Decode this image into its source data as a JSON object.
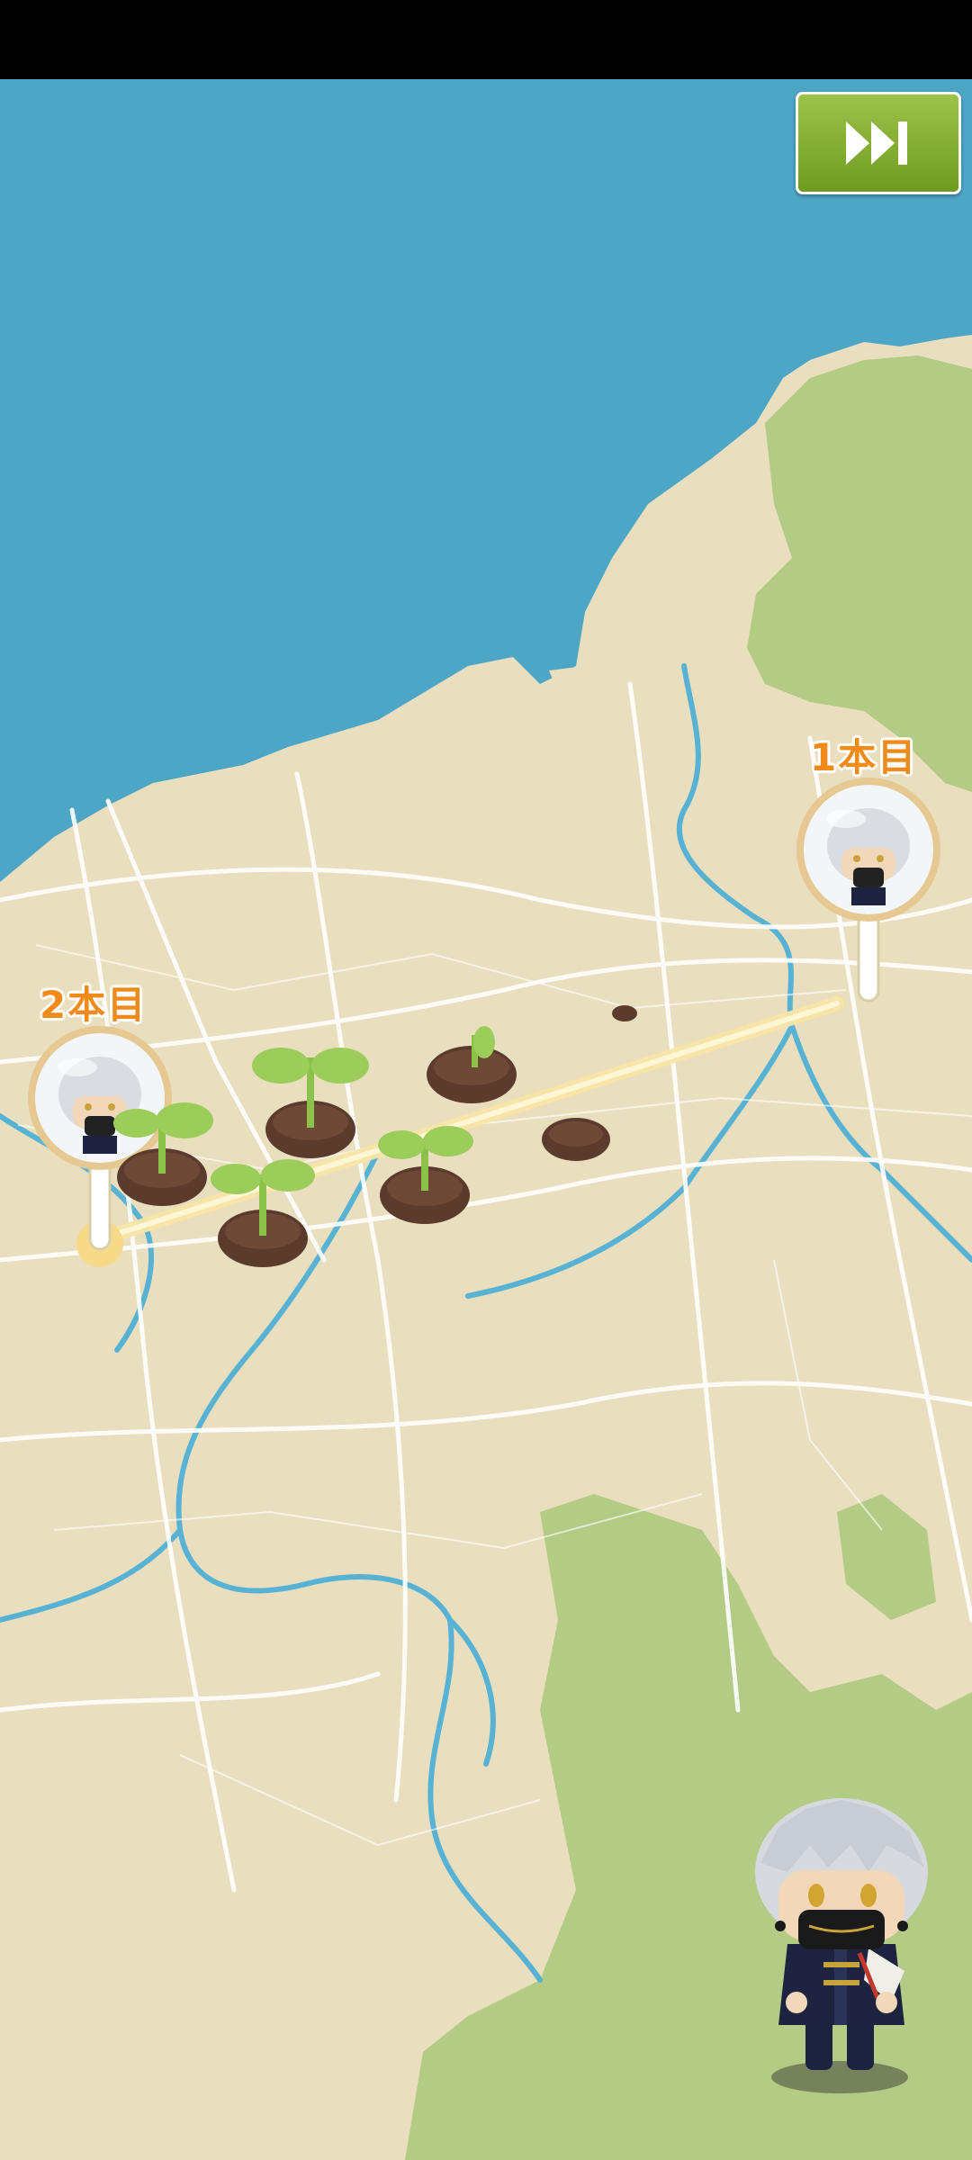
{
  "screen": "map-travel",
  "skip_button": {
    "icon": "fast-forward-icon",
    "color": "#8db33a"
  },
  "pins": [
    {
      "label": "1本目",
      "icon": "character-portrait-icon"
    },
    {
      "label": "2本目",
      "icon": "character-portrait-icon"
    }
  ],
  "sprouts_planted": 5,
  "plots_total": 7,
  "colors": {
    "sea": "#4ea6c7",
    "land": "#e9dfbf",
    "forest": "#a9c87a",
    "river": "#58b2d4",
    "road": "#ffffff",
    "route": "#f7e6a6",
    "label": "#f08b1a"
  }
}
